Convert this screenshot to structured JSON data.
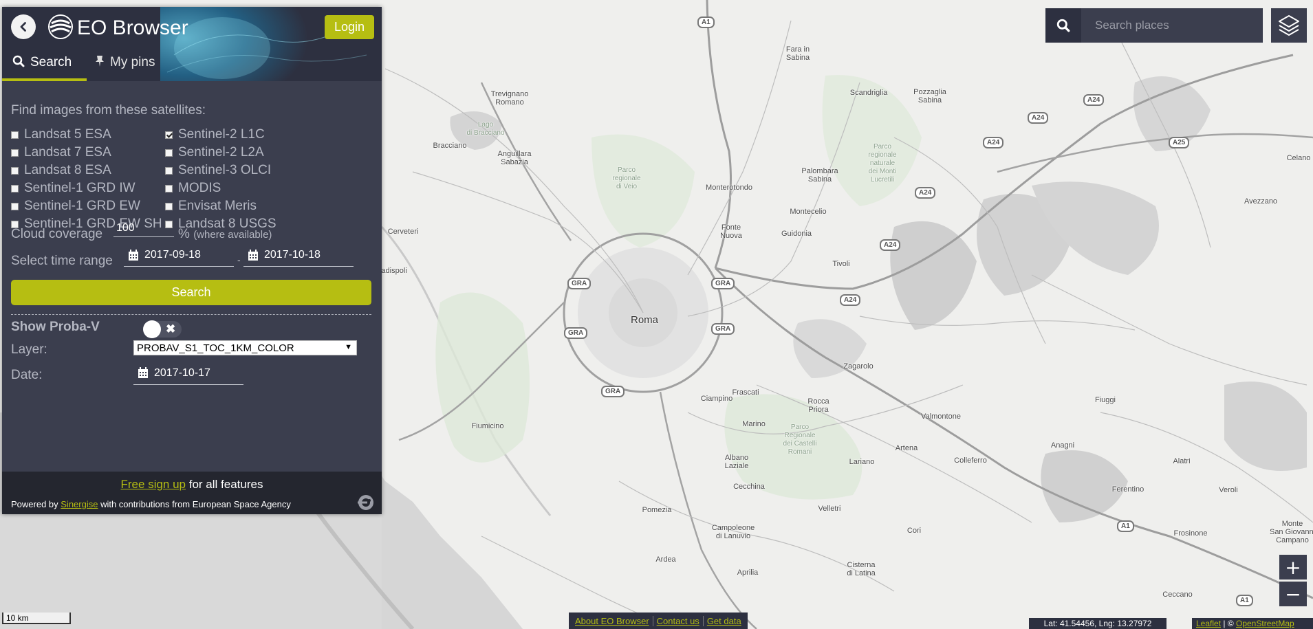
{
  "app": {
    "title": "EO Browser",
    "login_label": "Login"
  },
  "tabs": [
    {
      "label": "Search",
      "icon": "search-icon",
      "active": true
    },
    {
      "label": "My pins",
      "icon": "pin-icon",
      "active": false
    }
  ],
  "search_panel": {
    "find_label": "Find images from these satellites:",
    "satellites_left": [
      {
        "label": "Landsat 5 ESA",
        "checked": false
      },
      {
        "label": "Landsat 7 ESA",
        "checked": false
      },
      {
        "label": "Landsat 8 ESA",
        "checked": false
      },
      {
        "label": "Sentinel-1 GRD IW",
        "checked": false
      },
      {
        "label": "Sentinel-1 GRD EW",
        "checked": false
      },
      {
        "label": "Sentinel-1 GRD EW SH",
        "checked": false
      }
    ],
    "satellites_right": [
      {
        "label": "Sentinel-2 L1C",
        "checked": true
      },
      {
        "label": "Sentinel-2 L2A",
        "checked": false
      },
      {
        "label": "Sentinel-3 OLCI",
        "checked": false
      },
      {
        "label": "MODIS",
        "checked": false
      },
      {
        "label": "Envisat Meris",
        "checked": false
      },
      {
        "label": "Landsat 8 USGS",
        "checked": false
      }
    ],
    "cloud_label": "Cloud coverage",
    "cloud_value": "100",
    "cloud_unit": "%",
    "cloud_note": "(where available)",
    "time_label": "Select time range",
    "date_from": "2017-09-18",
    "date_separator": "-",
    "date_to": "2017-10-18",
    "search_label": "Search"
  },
  "proba": {
    "label": "Show Proba-V",
    "enabled": false,
    "toggle_off_symbol": "✖",
    "layer_label": "Layer:",
    "layer_value": "PROBAV_S1_TOC_1KM_COLOR",
    "date_label": "Date:",
    "date_value": "2017-10-17"
  },
  "footer": {
    "signup_link": "Free sign up",
    "signup_rest": " for all features",
    "powered_prefix": "Powered by ",
    "powered_link": "Sinergise",
    "powered_suffix": " with contributions from European Space Agency"
  },
  "place_search": {
    "placeholder": "Search places"
  },
  "zoom": {
    "in_label": "+",
    "out_label": "−"
  },
  "scale_label": "10 km",
  "bottom_links": [
    "About EO Browser",
    "Contact us",
    "Get data"
  ],
  "coordinates": "Lat: 41.54456, Lng: 13.27972",
  "attribution": {
    "leaflet": "Leaflet",
    "separator": " | © ",
    "osm": "OpenStreetMap"
  },
  "colors": {
    "accent": "#b6be12",
    "panel_bg": "#3b3e4e",
    "header_bg": "#2d3040",
    "footer_bg": "#24262f"
  },
  "map": {
    "labels": [
      {
        "text": "Roma",
        "cls": "city"
      },
      {
        "text": "Trevignano\nRomano"
      },
      {
        "text": "Lago\ndi Bracciano",
        "cls": "park"
      },
      {
        "text": "Bracciano"
      },
      {
        "text": "Anguillara\nSabazia"
      },
      {
        "text": "Fara in\nSabina"
      },
      {
        "text": "Scandriglia"
      },
      {
        "text": "Pozzaglia\nSabina"
      },
      {
        "text": "Palombara\nSabina"
      },
      {
        "text": "Parco\nregionale\nnaturale\ndei Monti\nLucretili",
        "cls": "park"
      },
      {
        "text": "Monterotondo"
      },
      {
        "text": "Montecelio"
      },
      {
        "text": "Guidonia"
      },
      {
        "text": "Fonte\nNuova"
      },
      {
        "text": "Tivoli"
      },
      {
        "text": "Cerveteri"
      },
      {
        "text": "Zagarolo"
      },
      {
        "text": "Frascati"
      },
      {
        "text": "Ciampino"
      },
      {
        "text": "Rocca\nPriora"
      },
      {
        "text": "Marino"
      },
      {
        "text": "Parco\nRegionale\ndei Castelli\nRomani",
        "cls": "park"
      },
      {
        "text": "Albano\nLaziale"
      },
      {
        "text": "Lariano"
      },
      {
        "text": "Valmontone"
      },
      {
        "text": "Artena"
      },
      {
        "text": "Colleferro"
      },
      {
        "text": "Anagni"
      },
      {
        "text": "Fiumicino"
      },
      {
        "text": "Cecchina"
      },
      {
        "text": "Pomezia"
      },
      {
        "text": "Velletri"
      },
      {
        "text": "Campoleone\ndi Lanuvio"
      },
      {
        "text": "Cori"
      },
      {
        "text": "Ardea"
      },
      {
        "text": "Aprilia"
      },
      {
        "text": "Cisterna\ndi Latina"
      },
      {
        "text": "Ferentino"
      },
      {
        "text": "Frosinone"
      },
      {
        "text": "Alatri"
      },
      {
        "text": "Fiuggi"
      },
      {
        "text": "Veroli"
      },
      {
        "text": "Ceccano"
      },
      {
        "text": "Avezzano"
      },
      {
        "text": "Celano"
      },
      {
        "text": "Monte\nSan Giovanni\nCampano"
      },
      {
        "text": "Parco\nregionale\ndi Veio",
        "cls": "park"
      },
      {
        "text": "Ladispoli"
      }
    ],
    "shields": [
      "A1",
      "A24",
      "A24",
      "A24",
      "A25",
      "A24",
      "A24",
      "A24",
      "GRA",
      "GRA",
      "GRA",
      "GRA",
      "GRA",
      "A1",
      "A1"
    ]
  }
}
